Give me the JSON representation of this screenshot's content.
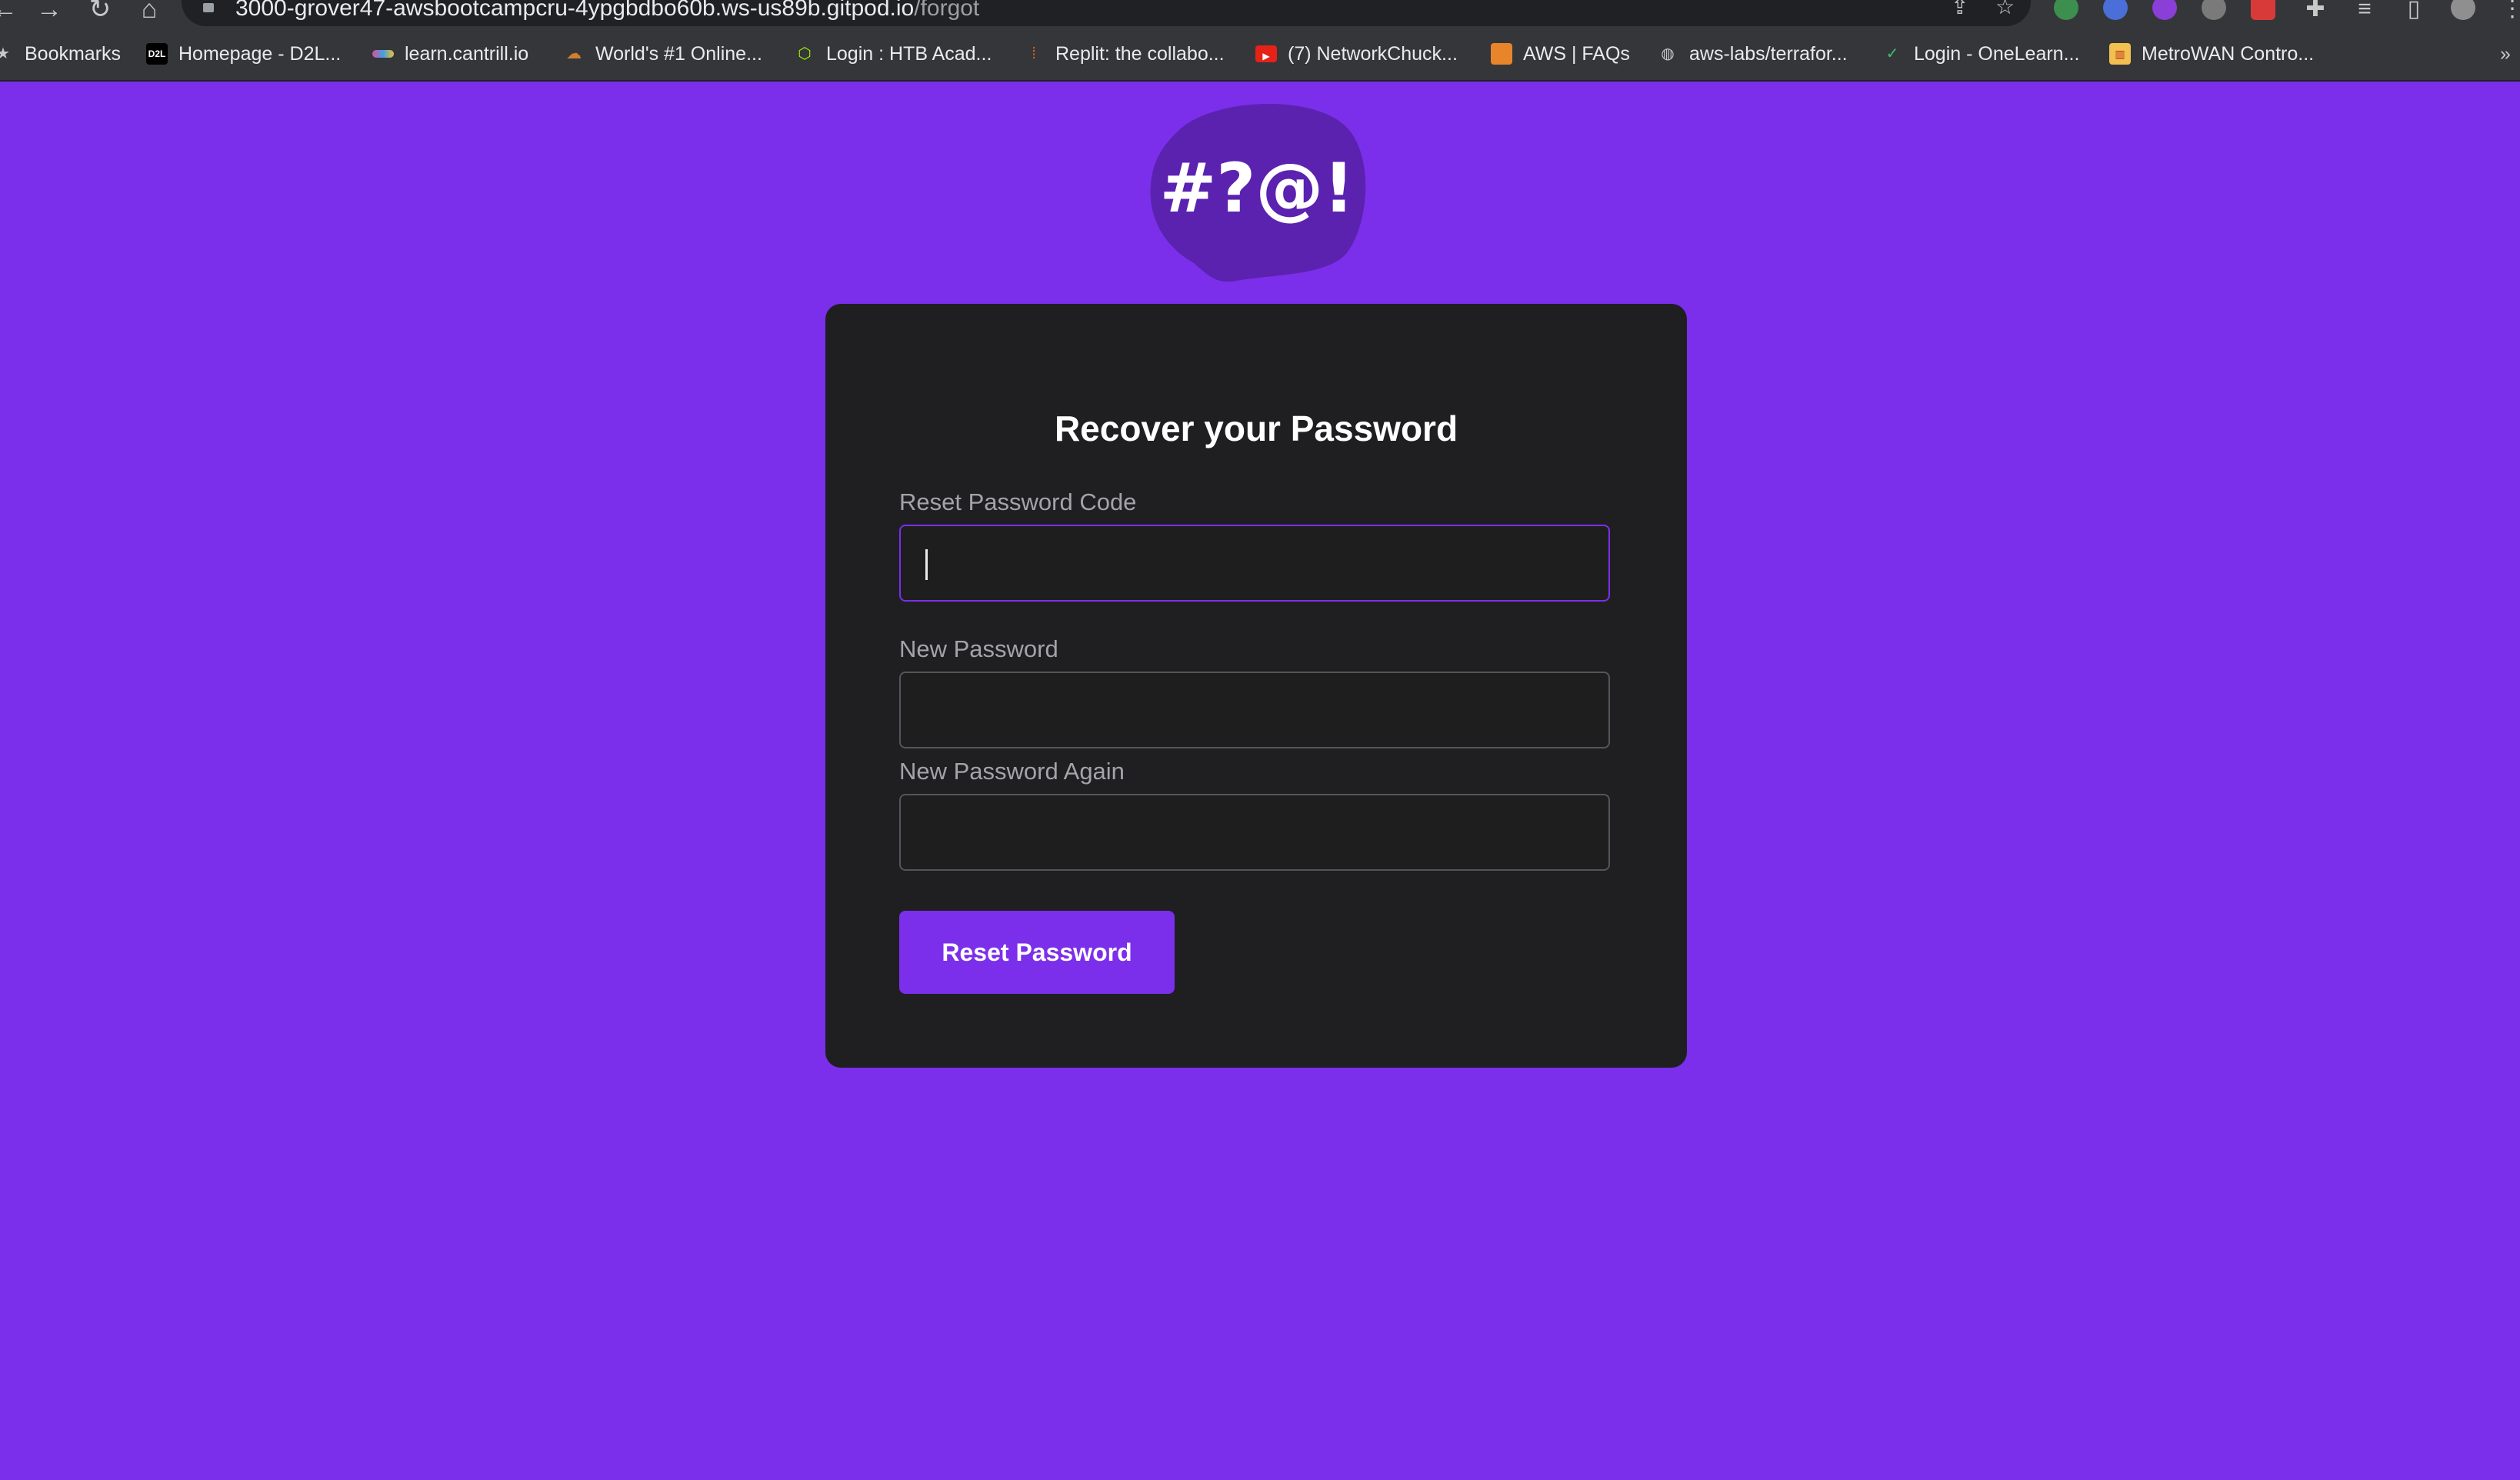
{
  "browser": {
    "url_host": "3000-grover47-awsbootcampcru-4ypgbdbo60b.ws-us89b.gitpod.io",
    "url_path": "/forgot",
    "bookmarks": [
      {
        "label": "Bookmarks",
        "icon": "star-icon"
      },
      {
        "label": "Homepage - D2L...",
        "icon": "d2l-icon",
        "icon_text": "D2L"
      },
      {
        "label": "learn.cantrill.io",
        "icon": "cantrill-icon"
      },
      {
        "label": "World's #1 Online...",
        "icon": "cloud-icon"
      },
      {
        "label": "Login : HTB Acad...",
        "icon": "cube-icon"
      },
      {
        "label": "Replit: the collabo...",
        "icon": "replit-icon"
      },
      {
        "label": "(7) NetworkChuck...",
        "icon": "youtube-icon"
      },
      {
        "label": "AWS | FAQs",
        "icon": "aws-box-icon"
      },
      {
        "label": "aws-labs/terrafor...",
        "icon": "globe-icon"
      },
      {
        "label": "Login - OneLearn...",
        "icon": "check-icon"
      },
      {
        "label": "MetroWAN Contro...",
        "icon": "metrowan-icon"
      }
    ]
  },
  "logo": {
    "text": "#?@!",
    "icon": "speech-bubble-logo-icon"
  },
  "form": {
    "title": "Recover your Password",
    "fields": [
      {
        "label": "Reset Password Code",
        "value": ""
      },
      {
        "label": "New Password",
        "value": ""
      },
      {
        "label": "New Password Again",
        "value": ""
      }
    ],
    "submit_label": "Reset Password"
  },
  "colors": {
    "page_background": "#7b2fea",
    "card_background": "#1f1f22",
    "accent": "#7b2fea",
    "logo_bubble": "#5b22b0"
  }
}
